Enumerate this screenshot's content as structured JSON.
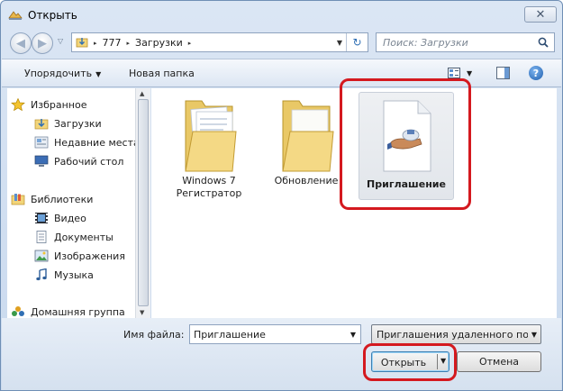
{
  "window": {
    "title": "Открыть",
    "close_glyph": "✕"
  },
  "nav": {
    "back_glyph": "◀",
    "forward_glyph": "▶",
    "history_glyph": "▽"
  },
  "address": {
    "crumbs": [
      "777",
      "Загрузки"
    ],
    "separator": "▸",
    "dropdown_glyph": "▼",
    "refresh_glyph": "↻"
  },
  "search": {
    "placeholder": "Поиск: Загрузки"
  },
  "toolbar": {
    "organize_label": "Упорядочить",
    "organize_arrow": "▼",
    "new_folder_label": "Новая папка",
    "views_drop": "▼",
    "help_glyph": "?"
  },
  "sidebar": {
    "favorites": {
      "label": "Избранное",
      "items": [
        "Загрузки",
        "Недавние места",
        "Рабочий стол"
      ]
    },
    "libraries": {
      "label": "Библиотеки",
      "items": [
        "Видео",
        "Документы",
        "Изображения",
        "Музыка"
      ]
    },
    "homegroup": {
      "label": "Домашняя группа"
    }
  },
  "files": [
    {
      "name_line1": "Windows 7",
      "name_line2": "Регистратор",
      "type": "folder"
    },
    {
      "name_line1": "Обновление",
      "type": "folder"
    },
    {
      "name_line1": "Приглашение",
      "type": "invitation-file",
      "selected": true
    }
  ],
  "footer": {
    "filename_label": "Имя файла:",
    "filename_value": "Приглашение",
    "filetype_value": "Приглашения удаленного по",
    "open_label": "Открыть",
    "cancel_label": "Отмена",
    "drop_glyph": "▼"
  },
  "colors": {
    "highlight": "#d4191f",
    "folder": "#f2d57a",
    "accent": "#2f6fb4"
  }
}
